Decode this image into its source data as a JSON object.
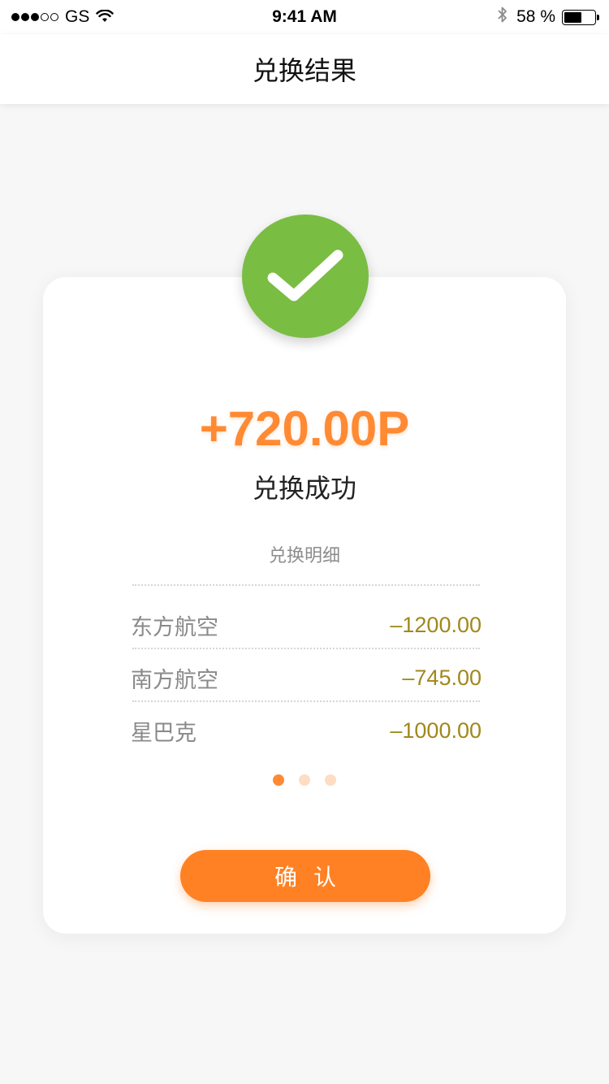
{
  "status_bar": {
    "carrier": "GS",
    "time": "9:41 AM",
    "battery_percent": "58 %",
    "battery_level": 0.58,
    "signal_filled": 3,
    "signal_total": 5
  },
  "nav": {
    "title": "兑换结果"
  },
  "result": {
    "points": "+720.00P",
    "message": "兑换成功",
    "detail_title": "兑换明细"
  },
  "details": [
    {
      "name": "东方航空",
      "amount": "–1200.00"
    },
    {
      "name": "南方航空",
      "amount": "–745.00"
    },
    {
      "name": "星巴克",
      "amount": "–1000.00"
    }
  ],
  "pager": {
    "total": 3,
    "active": 0
  },
  "confirm_button": {
    "label": "确认"
  },
  "colors": {
    "success_green": "#79bd43",
    "accent_orange": "#ff8a34",
    "button_orange": "#ff8124",
    "amount_gold": "#a0881c",
    "pager_active": "#ff8a34",
    "pager_inactive": "#ffdcc2"
  }
}
